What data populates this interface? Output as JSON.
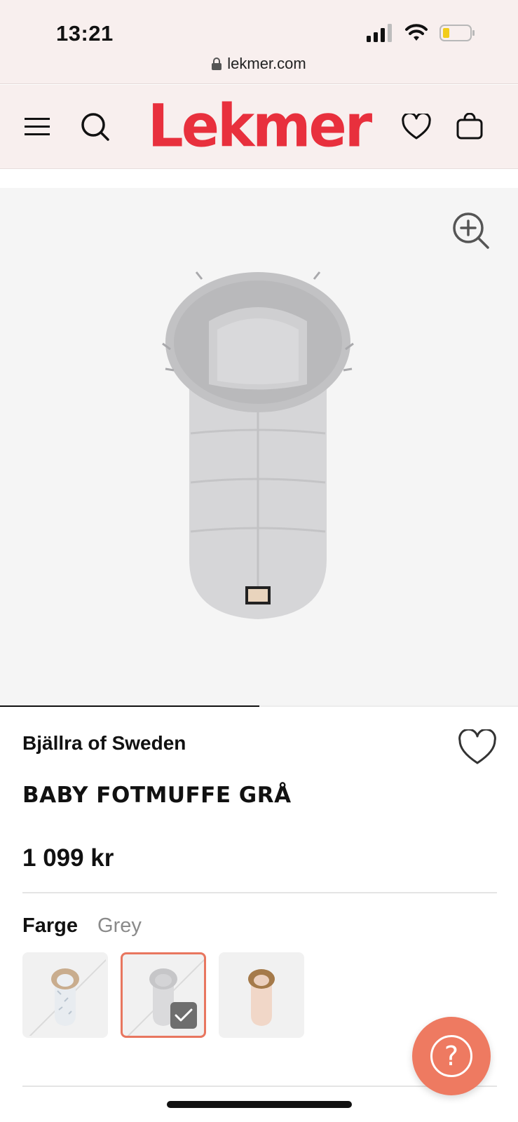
{
  "status_bar": {
    "time": "13:21",
    "url": "lekmer.com"
  },
  "header": {
    "logo": "Lekmer",
    "icons": [
      "menu-icon",
      "search-icon",
      "heart-icon",
      "bag-icon"
    ]
  },
  "hero": {
    "image_alt": "Baby fotmuffe grå",
    "carousel_progress": 0.5
  },
  "product": {
    "brand": "Bjällra of Sweden",
    "title": "BABY FOTMUFFE GRÅ",
    "price": "1 099 kr",
    "color_label": "Farge",
    "color_value": "Grey",
    "swatches": [
      {
        "name": "white",
        "selected": false,
        "available": false
      },
      {
        "name": "grey",
        "selected": true,
        "available": false
      },
      {
        "name": "beige",
        "selected": false,
        "available": true
      }
    ]
  },
  "help_button": {
    "icon": "question-icon",
    "label": "?"
  },
  "colors": {
    "logo_red": "#e8303d",
    "accent": "#ee7a61",
    "header_bg": "#f8efee"
  }
}
